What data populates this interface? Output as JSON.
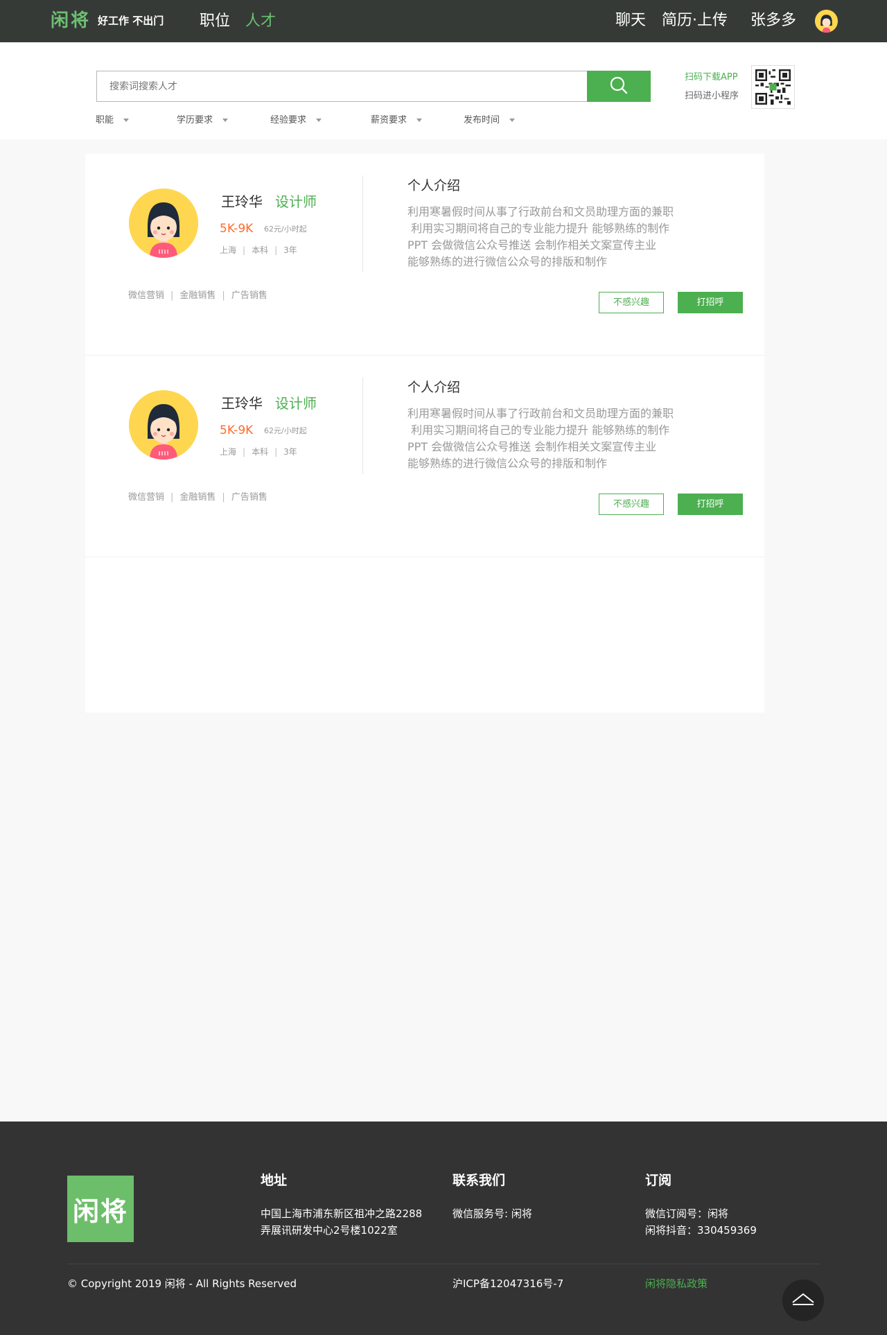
{
  "header": {
    "logo": "闲将",
    "slogan": "好工作 不出门",
    "nav": [
      {
        "label": "职位",
        "active": false
      },
      {
        "label": "人才",
        "active": true
      }
    ],
    "chat": "聊天",
    "resume_upload": "简历·上传",
    "username": "张多多"
  },
  "search": {
    "placeholder": "搜索词搜索人才",
    "filters": [
      "职能",
      "学历要求",
      "经验要求",
      "薪资要求",
      "发布时间"
    ],
    "qr_download": "扫码下载APP",
    "qr_miniprogram": "扫码进小程序"
  },
  "candidates": [
    {
      "name": "王玲华",
      "role": "设计师",
      "salary": "5K-9K",
      "rate": "62元/小时起",
      "city": "上海",
      "education": "本科",
      "experience": "3年",
      "tags": [
        "微信营销",
        "金融销售",
        "广告销售"
      ],
      "intro_title": "个人介绍",
      "intro_lines": [
        "利用寒暑假时间从事了行政前台和文员助理方面的兼职",
        " 利用实习期间将自己的专业能力提升 能够熟练的制作",
        "PPT 会做微信公众号推送 会制作相关文案宣传主业",
        "能够熟练的进行微信公众号的排版和制作"
      ],
      "btn_not_interested": "不感兴趣",
      "btn_greet": "打招呼"
    },
    {
      "name": "王玲华",
      "role": "设计师",
      "salary": "5K-9K",
      "rate": "62元/小时起",
      "city": "上海",
      "education": "本科",
      "experience": "3年",
      "tags": [
        "微信营销",
        "金融销售",
        "广告销售"
      ],
      "intro_title": "个人介绍",
      "intro_lines": [
        "利用寒暑假时间从事了行政前台和文员助理方面的兼职",
        " 利用实习期间将自己的专业能力提升 能够熟练的制作",
        "PPT 会做微信公众号推送 会制作相关文案宣传主业",
        "能够熟练的进行微信公众号的排版和制作"
      ],
      "btn_not_interested": "不感兴趣",
      "btn_greet": "打招呼"
    }
  ],
  "footer": {
    "logo": "闲将",
    "address_title": "地址",
    "address_lines": [
      "中国上海市浦东新区祖冲之路2288",
      "弄展讯研发中心2号楼1022室"
    ],
    "contact_title": "联系我们",
    "contact_lines": [
      "微信服务号: 闲将"
    ],
    "subscribe_title": "订阅",
    "subscribe_lines": [
      "微信订阅号：闲将",
      "闲将抖音：330459369"
    ],
    "copyright": "© Copyright 2019 闲将 - All Rights Reserved",
    "icp": "沪ICP备12047316号-7",
    "privacy": "闲将隐私政策"
  },
  "colors": {
    "brand_green": "#4caf50",
    "header_bg": "#363a37",
    "footer_bg": "#333333",
    "salary_orange": "#ff6a2a"
  },
  "icons": [
    "search-icon",
    "qr-code-icon",
    "avatar-icon",
    "caret-down-icon",
    "back-to-top-icon"
  ]
}
